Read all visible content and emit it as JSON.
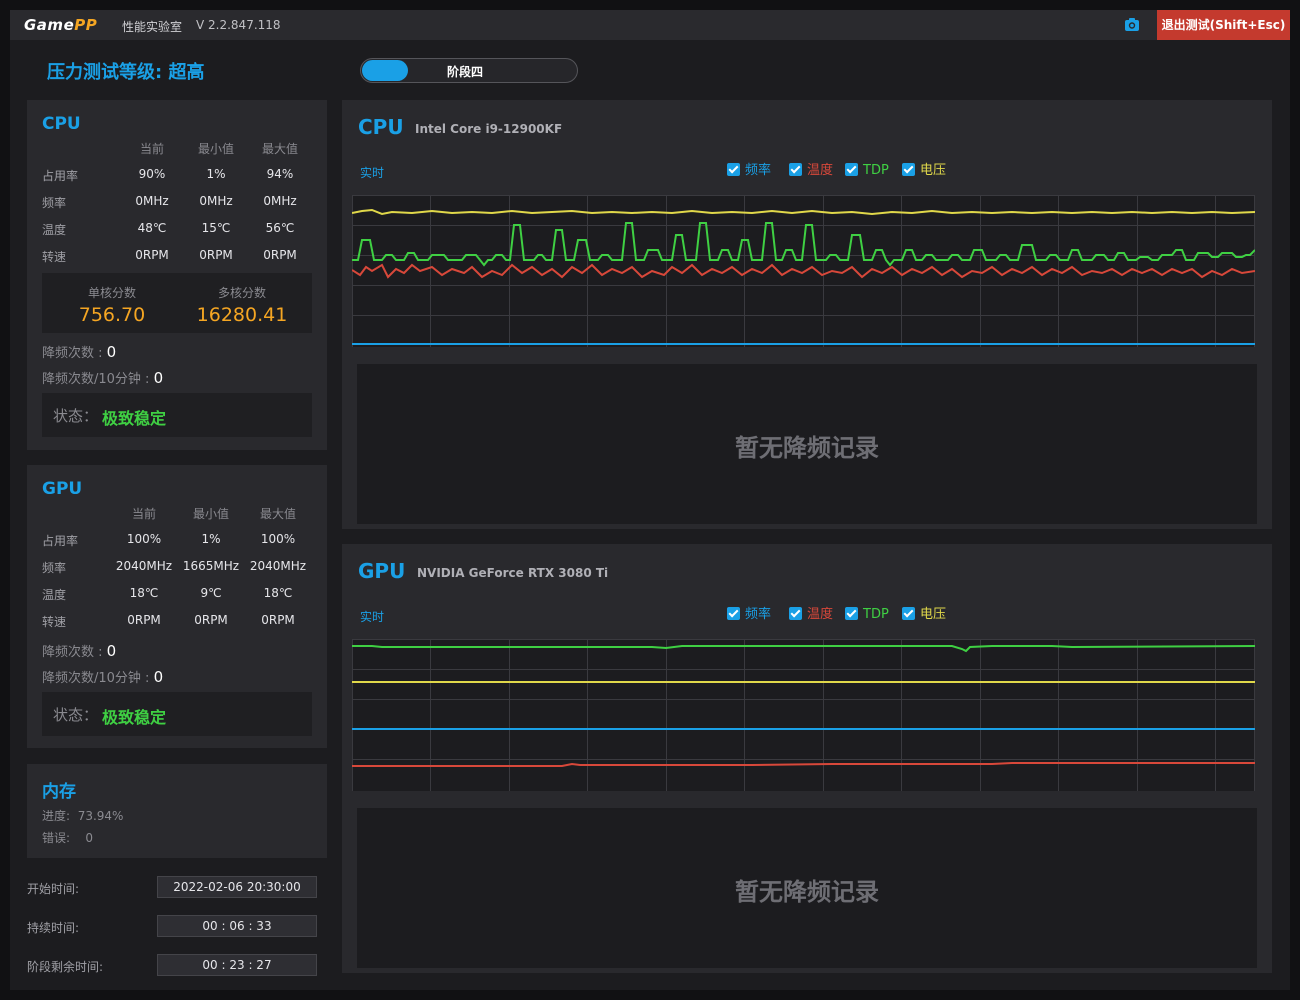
{
  "app": {
    "logo_main": "Game",
    "logo_accent": "PP",
    "name": "性能实验室",
    "version": "V 2.2.847.118",
    "exit_label": "退出测试(Shift+Esc)",
    "camera_icon": "camera-icon"
  },
  "test": {
    "level_title": "压力测试等级: 超高",
    "stage_label": "阶段四"
  },
  "cpu_panel": {
    "title": "CPU",
    "headers": [
      "当前",
      "最小值",
      "最大值"
    ],
    "rows": [
      {
        "label": "占用率",
        "values": [
          "90%",
          "1%",
          "94%"
        ]
      },
      {
        "label": "频率",
        "values": [
          "0MHz",
          "0MHz",
          "0MHz"
        ]
      },
      {
        "label": "温度",
        "values": [
          "48℃",
          "15℃",
          "56℃"
        ]
      },
      {
        "label": "转速",
        "values": [
          "0RPM",
          "0RPM",
          "0RPM"
        ]
      }
    ],
    "single_score_label": "单核分数",
    "single_score": "756.70",
    "multi_score_label": "多核分数",
    "multi_score": "16280.41",
    "throttle_label": "降频次数 : ",
    "throttle_value": "0",
    "throttle10_label": "降频次数/10分钟 : ",
    "throttle10_value": "0",
    "status_label": "状态：",
    "status_value": "极致稳定"
  },
  "gpu_panel": {
    "title": "GPU",
    "headers": [
      "当前",
      "最小值",
      "最大值"
    ],
    "rows": [
      {
        "label": "占用率",
        "values": [
          "100%",
          "1%",
          "100%"
        ]
      },
      {
        "label": "频率",
        "values": [
          "2040MHz",
          "1665MHz",
          "2040MHz"
        ]
      },
      {
        "label": "温度",
        "values": [
          "18℃",
          "9℃",
          "18℃"
        ]
      },
      {
        "label": "转速",
        "values": [
          "0RPM",
          "0RPM",
          "0RPM"
        ]
      }
    ],
    "throttle_label": "降频次数 : ",
    "throttle_value": "0",
    "throttle10_label": "降频次数/10分钟 : ",
    "throttle10_value": "0",
    "status_label": "状态：",
    "status_value": "极致稳定"
  },
  "memory_panel": {
    "title": "内存",
    "progress_label": "进度:",
    "progress_value": "73.94%",
    "error_label": "错误:",
    "error_value": "0"
  },
  "times": {
    "start_label": "开始时间:",
    "start_value": "2022-02-06 20:30:00",
    "duration_label": "持续时间:",
    "duration_value": "00 : 06 : 33",
    "remaining_label": "阶段剩余时间:",
    "remaining_value": "00 : 23 : 27"
  },
  "cpu_chart": {
    "title": "CPU",
    "model": "Intel Core i9-12900KF",
    "realtime_label": "实时",
    "legend": [
      {
        "label": "频率",
        "color": "#1aa0e6",
        "checked": true
      },
      {
        "label": "温度",
        "color": "#d8483a",
        "checked": true
      },
      {
        "label": "TDP",
        "color": "#3fd043",
        "checked": true
      },
      {
        "label": "电压",
        "color": "#e0d84a",
        "checked": true
      }
    ],
    "no_record_text": "暂无降频记录"
  },
  "gpu_chart": {
    "title": "GPU",
    "model": "NVIDIA GeForce RTX 3080 Ti",
    "realtime_label": "实时",
    "legend": [
      {
        "label": "频率",
        "color": "#1aa0e6",
        "checked": true
      },
      {
        "label": "温度",
        "color": "#d8483a",
        "checked": true
      },
      {
        "label": "TDP",
        "color": "#3fd043",
        "checked": true
      },
      {
        "label": "电压",
        "color": "#e0d84a",
        "checked": true
      }
    ],
    "no_record_text": "暂无降频记录"
  }
}
